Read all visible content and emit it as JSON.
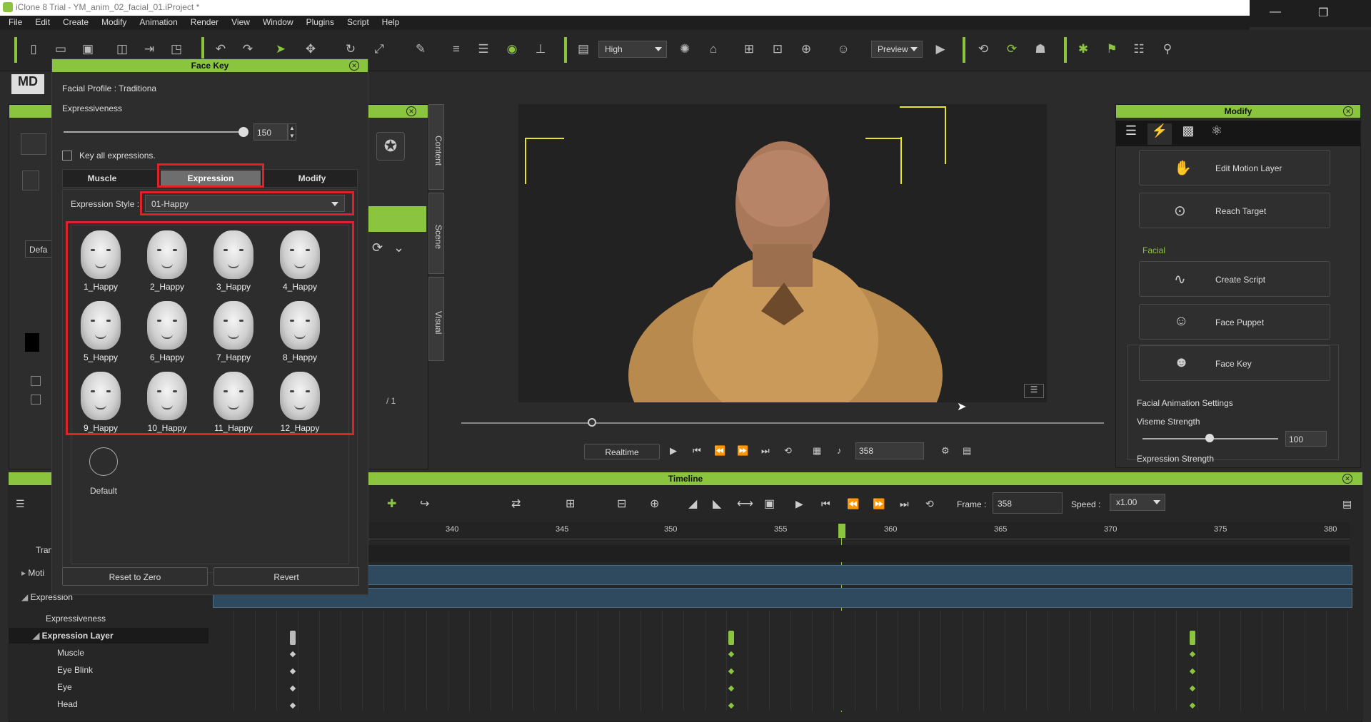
{
  "window": {
    "title": "iClone 8 Trial - YM_anim_02_facial_01.iProject *"
  },
  "menu": [
    "File",
    "Edit",
    "Create",
    "Modify",
    "Animation",
    "Render",
    "View",
    "Window",
    "Plugins",
    "Script",
    "Help"
  ],
  "toolbar": {
    "quality": "High",
    "preview": "Preview"
  },
  "facekey": {
    "title": "Face Key",
    "profile_label": "Facial Profile :",
    "profile_value": "Traditiona",
    "expressiveness_label": "Expressiveness",
    "expressiveness_value": "150",
    "expressiveness_level": 1.0,
    "key_all_label": "Key all expressions.",
    "tabs": [
      "Muscle",
      "Expression",
      "Modify"
    ],
    "active_tab": "Expression",
    "style_label": "Expression Style :",
    "style_value": "01-Happy",
    "expressions": [
      "1_Happy",
      "2_Happy",
      "3_Happy",
      "4_Happy",
      "5_Happy",
      "6_Happy",
      "7_Happy",
      "8_Happy",
      "9_Happy",
      "10_Happy",
      "11_Happy",
      "12_Happy"
    ],
    "default_label": "Default",
    "reset_label": "Reset to Zero",
    "revert_label": "Revert"
  },
  "leftpanel": {
    "vtabs": [
      "Content",
      "Scene",
      "Visual"
    ],
    "default_text": "Defa",
    "page": "/ 1"
  },
  "viewport": {
    "realtime_label": "Realtime",
    "frame": "358"
  },
  "modify": {
    "title": "Modify",
    "buttons": [
      "Edit Motion Layer",
      "Reach Target"
    ],
    "facial_section": "Facial",
    "facial_buttons": [
      "Create Script",
      "Face Puppet",
      "Face Key"
    ],
    "fas_title": "Facial Animation Settings",
    "viseme_label": "Viseme Strength",
    "viseme_value": "100",
    "expr_strength_label": "Expression Strength"
  },
  "timeline": {
    "title": "Timeline",
    "frame_label": "Frame :",
    "frame_value": "358",
    "speed_label": "Speed :",
    "speed_value": "x1.00",
    "ruler": [
      "340",
      "345",
      "350",
      "355",
      "360",
      "365",
      "370",
      "375",
      "380"
    ],
    "tracks": [
      "Tran",
      "Moti",
      "Expression",
      "Expressiveness",
      "Expression Layer",
      "Muscle",
      "Eye Blink",
      "Eye",
      "Head"
    ]
  }
}
